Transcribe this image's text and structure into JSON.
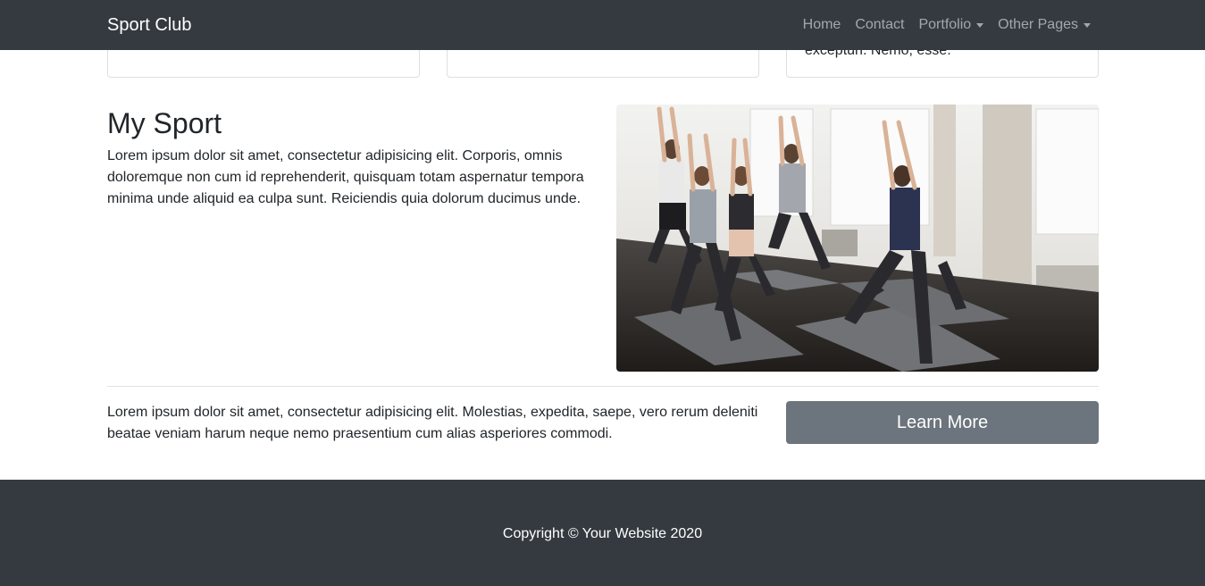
{
  "navbar": {
    "brand": "Sport Club",
    "items": [
      {
        "label": "Home",
        "dropdown": false
      },
      {
        "label": "Contact",
        "dropdown": false
      },
      {
        "label": "Portfolio",
        "dropdown": true
      },
      {
        "label": "Other Pages",
        "dropdown": true
      }
    ]
  },
  "cards": [
    {
      "text": ""
    },
    {
      "text": ""
    },
    {
      "text": "exceptun. Nemo, esse."
    }
  ],
  "section": {
    "title": "My Sport",
    "paragraph": "Lorem ipsum dolor sit amet, consectetur adipisicing elit. Corporis, omnis doloremque non cum id reprehenderit, quisquam totam aspernatur tempora minima unde aliquid ea culpa sunt. Reiciendis quia dolorum ducimus unde.",
    "image_subject": "yoga-class-photo"
  },
  "cta": {
    "text": "Lorem ipsum dolor sit amet, consectetur adipisicing elit. Molestias, expedita, saepe, vero rerum deleniti beatae veniam harum neque nemo praesentium cum alias asperiores commodi.",
    "button_label": "Learn More"
  },
  "footer": {
    "copyright": "Copyright © Your Website 2020"
  },
  "colors": {
    "navbar_bg": "#343a40",
    "button_bg": "#6c757d",
    "footer_bg": "#343a40"
  }
}
